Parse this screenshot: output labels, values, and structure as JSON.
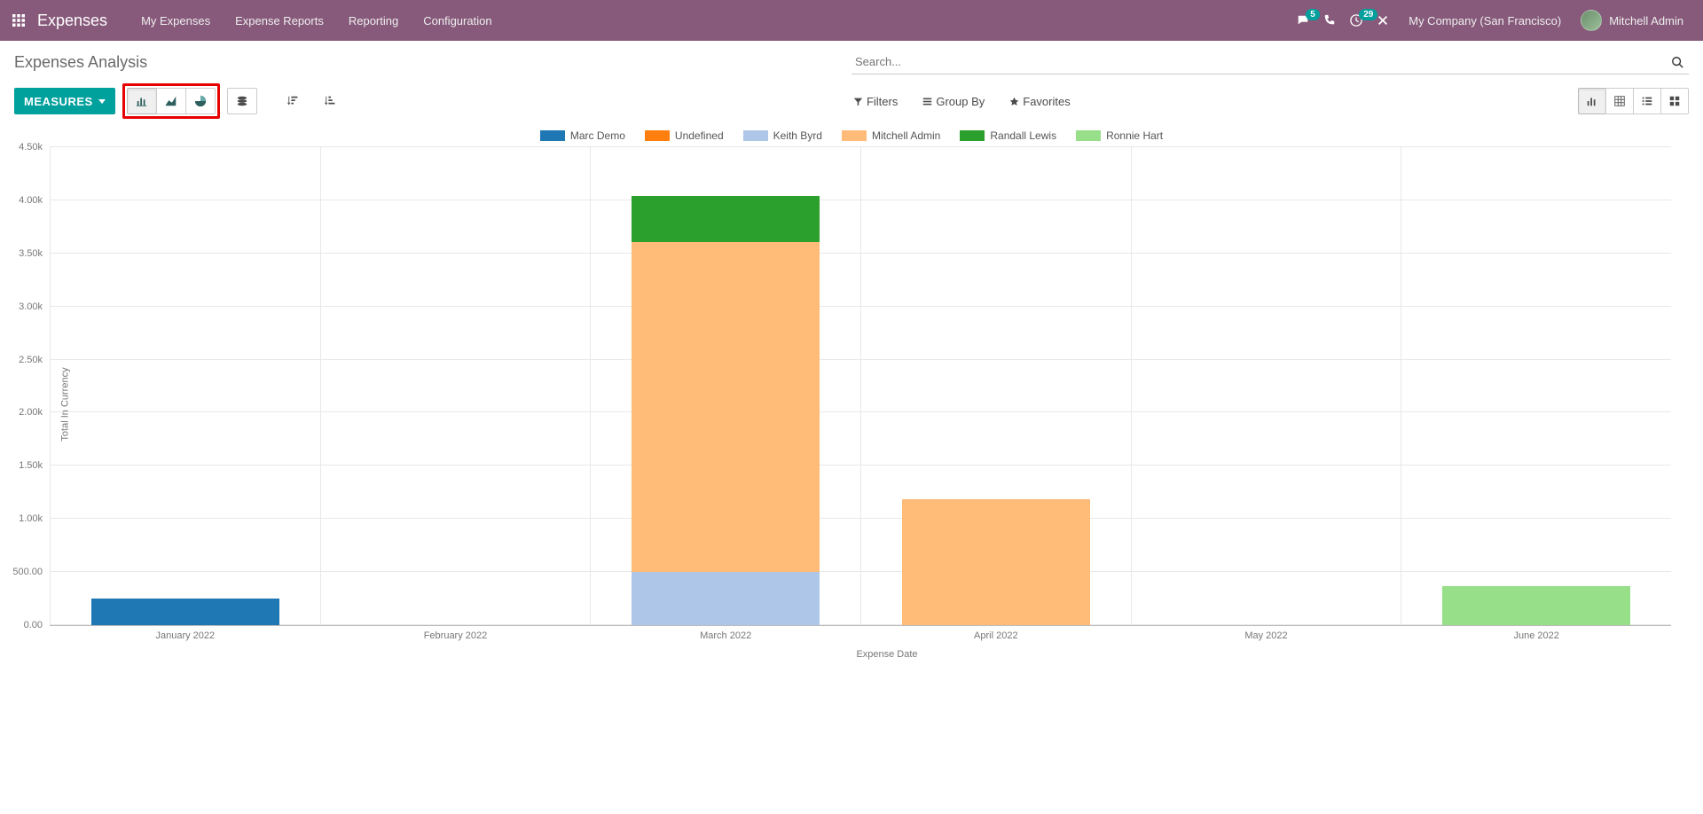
{
  "nav": {
    "brand": "Expenses",
    "links": [
      "My Expenses",
      "Expense Reports",
      "Reporting",
      "Configuration"
    ],
    "messages_badge": "5",
    "activities_badge": "29",
    "company": "My Company (San Francisco)",
    "user": "Mitchell Admin"
  },
  "page_title": "Expenses Analysis",
  "search": {
    "placeholder": "Search..."
  },
  "toolbar": {
    "measures_label": "MEASURES",
    "filters_label": "Filters",
    "groupby_label": "Group By",
    "favorites_label": "Favorites"
  },
  "legend_series": [
    {
      "name": "Marc Demo",
      "color": "#1f77b4"
    },
    {
      "name": "Undefined",
      "color": "#ff7f0e"
    },
    {
      "name": "Keith Byrd",
      "color": "#aec7e8"
    },
    {
      "name": "Mitchell Admin",
      "color": "#ffbb78"
    },
    {
      "name": "Randall Lewis",
      "color": "#2ca02c"
    },
    {
      "name": "Ronnie Hart",
      "color": "#98df8a"
    }
  ],
  "chart_data": {
    "type": "bar",
    "stacked": true,
    "xlabel": "Expense Date",
    "ylabel": "Total In Currency",
    "ylim": [
      0,
      4500
    ],
    "y_ticks": [
      0.0,
      500.0,
      1000,
      1500,
      2000,
      2500,
      3000,
      3500,
      4000,
      4500
    ],
    "y_tick_labels": [
      "0.00",
      "500.00",
      "1.00k",
      "1.50k",
      "2.00k",
      "2.50k",
      "3.00k",
      "3.50k",
      "4.00k",
      "4.50k"
    ],
    "categories": [
      "January 2022",
      "February 2022",
      "March 2022",
      "April 2022",
      "May 2022",
      "June 2022"
    ],
    "series": [
      {
        "name": "Marc Demo",
        "color": "#1f77b4",
        "values": [
          250,
          0,
          0,
          0,
          0,
          0
        ]
      },
      {
        "name": "Undefined",
        "color": "#ff7f0e",
        "values": [
          0,
          0,
          0,
          0,
          0,
          0
        ]
      },
      {
        "name": "Keith Byrd",
        "color": "#aec7e8",
        "values": [
          0,
          0,
          500,
          0,
          0,
          0
        ]
      },
      {
        "name": "Mitchell Admin",
        "color": "#ffbb78",
        "values": [
          0,
          0,
          3100,
          1180,
          0,
          0
        ]
      },
      {
        "name": "Randall Lewis",
        "color": "#2ca02c",
        "values": [
          0,
          0,
          430,
          0,
          0,
          0
        ]
      },
      {
        "name": "Ronnie Hart",
        "color": "#98df8a",
        "values": [
          0,
          0,
          0,
          0,
          0,
          370
        ]
      }
    ]
  }
}
